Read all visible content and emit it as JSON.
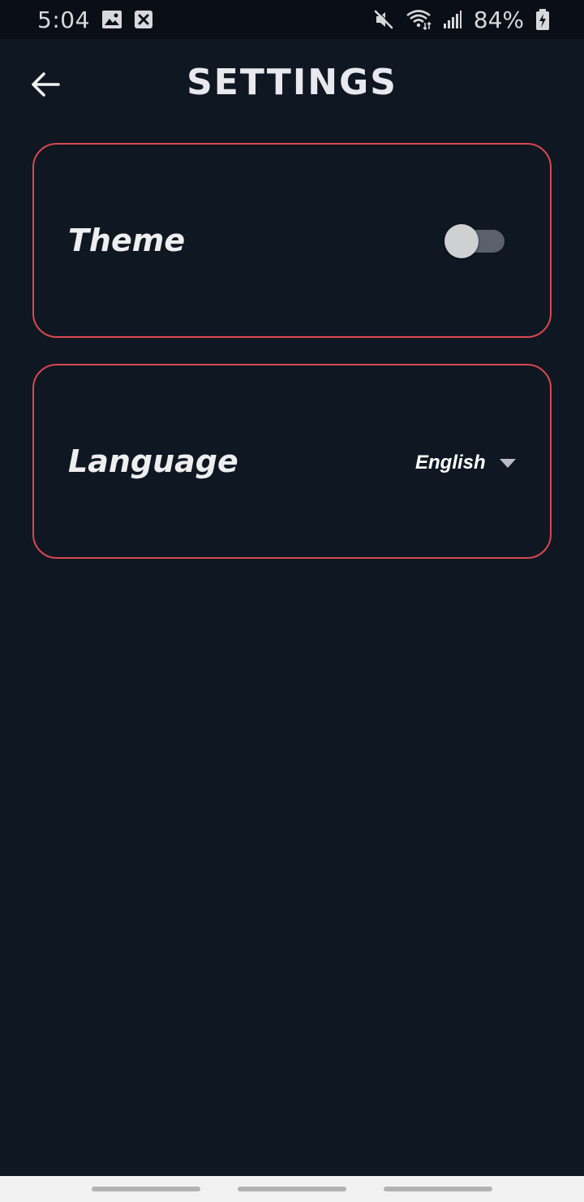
{
  "status_bar": {
    "time": "5:04",
    "battery_percent": "84%",
    "left_icons": [
      "image-icon",
      "close-box-icon"
    ],
    "right_icons": [
      "mute-icon",
      "wifi-icon",
      "signal-icon",
      "battery-charging-icon"
    ]
  },
  "header": {
    "title": "SETTINGS",
    "back_icon": "arrow-left-icon"
  },
  "settings": {
    "theme": {
      "label": "Theme",
      "toggle_on": false
    },
    "language": {
      "label": "Language",
      "selected": "English",
      "dropdown_icon": "caret-down-icon"
    }
  },
  "colors": {
    "background": "#0f1722",
    "card_border": "#d9484f",
    "text": "#e6e6ea",
    "toggle_track": "#5a616d",
    "toggle_thumb": "#cfd0d2"
  }
}
